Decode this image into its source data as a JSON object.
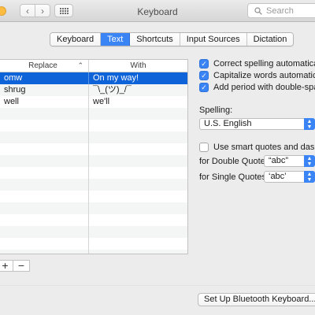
{
  "window": {
    "title": "Keyboard"
  },
  "toolbar": {
    "search_placeholder": "Search"
  },
  "tabs": [
    {
      "label": "Keyboard",
      "active": false
    },
    {
      "label": "Text",
      "active": true
    },
    {
      "label": "Shortcuts",
      "active": false
    },
    {
      "label": "Input Sources",
      "active": false
    },
    {
      "label": "Dictation",
      "active": false
    }
  ],
  "table": {
    "headers": {
      "replace": "Replace",
      "with": "With"
    },
    "rows": [
      {
        "replace": "omw",
        "with": "On my way!",
        "selected": true
      },
      {
        "replace": "shrug",
        "with": "¯\\_(ツ)_/¯",
        "selected": false
      },
      {
        "replace": "well",
        "with": "we'll",
        "selected": false
      }
    ]
  },
  "table_buttons": {
    "add": "+",
    "remove": "−"
  },
  "options": {
    "correct_spelling": {
      "label": "Correct spelling automatically",
      "checked": true
    },
    "capitalize": {
      "label": "Capitalize words automatically",
      "checked": true
    },
    "period": {
      "label": "Add period with double-space",
      "checked": true
    },
    "spelling_label": "Spelling:",
    "spelling_value": "U.S. English",
    "smart_quotes": {
      "label": "Use smart quotes and dashes",
      "checked": false
    },
    "double_quotes_label": "for Double Quotes",
    "double_quotes_value": "“abc”",
    "single_quotes_label": "for Single Quotes",
    "single_quotes_value": "‘abc’"
  },
  "bluetooth_button": "Set Up Bluetooth Keyboard...",
  "colors": {
    "accent": "#3a84f6",
    "selection": "#0f63d9"
  }
}
